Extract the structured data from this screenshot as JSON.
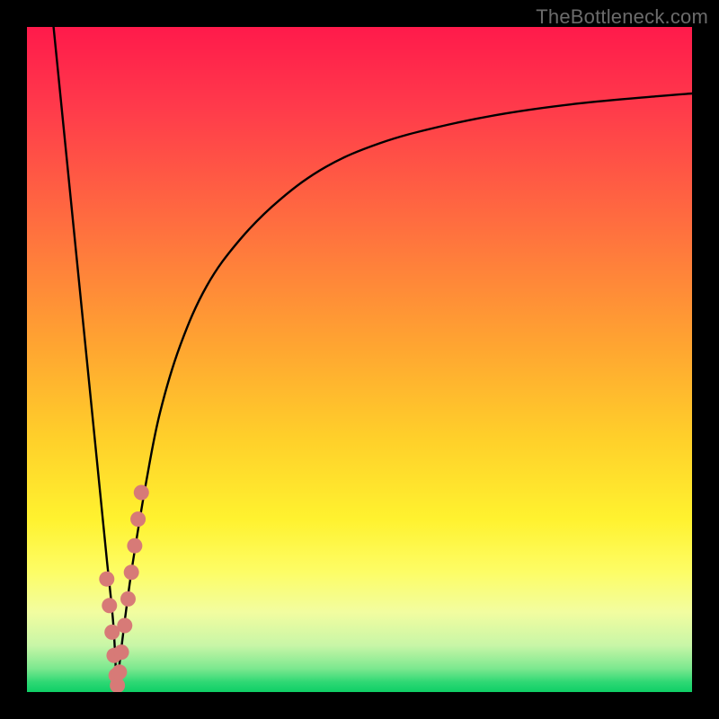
{
  "watermark": "TheBottleneck.com",
  "colors": {
    "frame": "#000000",
    "curve": "#000000",
    "marker": "#d77a77",
    "gradient_stops": [
      {
        "offset": 0.0,
        "color": "#ff1a4b"
      },
      {
        "offset": 0.12,
        "color": "#ff3a4b"
      },
      {
        "offset": 0.3,
        "color": "#ff6f3f"
      },
      {
        "offset": 0.48,
        "color": "#ffa531"
      },
      {
        "offset": 0.62,
        "color": "#ffd02a"
      },
      {
        "offset": 0.74,
        "color": "#fff22f"
      },
      {
        "offset": 0.82,
        "color": "#fdfd66"
      },
      {
        "offset": 0.88,
        "color": "#f2fda0"
      },
      {
        "offset": 0.93,
        "color": "#c8f6a7"
      },
      {
        "offset": 0.965,
        "color": "#7be88f"
      },
      {
        "offset": 0.985,
        "color": "#2fd874"
      },
      {
        "offset": 1.0,
        "color": "#0ecf66"
      }
    ]
  },
  "chart_data": {
    "type": "line",
    "title": "",
    "xlabel": "",
    "ylabel": "",
    "xlim": [
      0,
      100
    ],
    "ylim": [
      0,
      100
    ],
    "series": [
      {
        "name": "left-branch",
        "x": [
          4,
          5,
          6,
          7,
          8,
          9,
          10,
          11,
          12,
          13,
          13.5
        ],
        "y": [
          100,
          90,
          80,
          70,
          60,
          50,
          40,
          30,
          20,
          10,
          0
        ]
      },
      {
        "name": "right-branch",
        "x": [
          13.5,
          14,
          15,
          16,
          18,
          20,
          23,
          27,
          32,
          38,
          45,
          53,
          62,
          72,
          83,
          95,
          100
        ],
        "y": [
          0,
          5,
          13,
          20,
          32,
          42,
          52,
          61,
          68,
          74,
          79,
          82.5,
          85,
          87,
          88.5,
          89.6,
          90
        ]
      }
    ],
    "markers": {
      "name": "highlighted-points",
      "x": [
        12.0,
        12.4,
        12.8,
        13.1,
        13.4,
        13.6,
        13.9,
        14.2,
        14.7,
        15.2,
        15.7,
        16.2,
        16.7,
        17.2
      ],
      "y": [
        17.0,
        13.0,
        9.0,
        5.5,
        2.5,
        1.0,
        3.0,
        6.0,
        10.0,
        14.0,
        18.0,
        22.0,
        26.0,
        30.0
      ]
    }
  }
}
